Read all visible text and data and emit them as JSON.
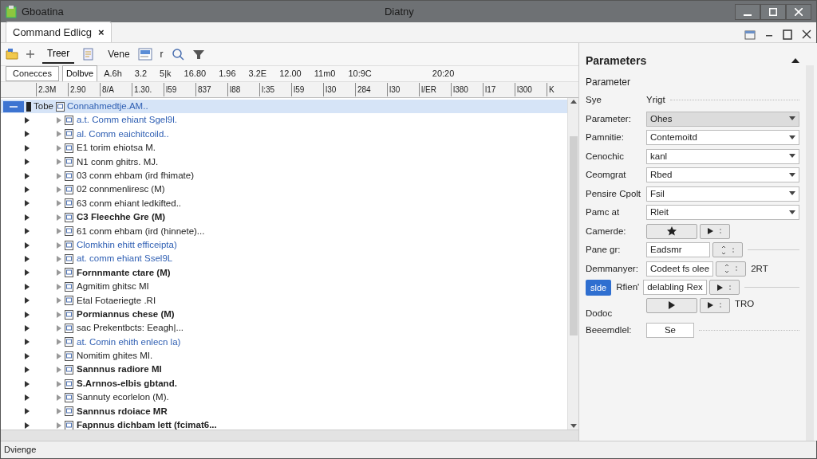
{
  "window": {
    "title": "Gboatina",
    "subtitle": "Diatny"
  },
  "tabs": [
    {
      "label": "Command Edlicg",
      "selected": true,
      "close": "×"
    }
  ],
  "toolbar": {
    "tab_label": "Treer",
    "view_label": "Vene",
    "view_suffix": "r"
  },
  "ruler": {
    "filter": "Conecces",
    "button": "Dolbve",
    "labels": [
      "A.6h",
      "3.2",
      "5|k",
      "16.80",
      "1.96",
      "3.2E",
      "12.00",
      "11m0",
      "10:9C",
      "20:20"
    ],
    "ticks": [
      "2.3M",
      "2.90",
      "8/A",
      "1.30.",
      "l59",
      "837",
      "l88",
      "l:35",
      "l59",
      "l30",
      "284",
      "l30",
      "l/ER",
      "l380",
      "l17",
      "l300",
      "K"
    ]
  },
  "tree": {
    "rows": [
      {
        "prefix": "Tobe",
        "text": "Connahmedtje.AM..",
        "color": "#2f5fb3",
        "bold": false,
        "selected": true,
        "expanded": true,
        "children": [
          {
            "text": "a.t. Comm ehiant Sgel9l.",
            "color": "#2f5fb3",
            "bold": false,
            "selected": false
          },
          {
            "text": "al. Comm eaichitcoild..",
            "color": "#2f5fb3",
            "bold": false,
            "selected": false
          },
          {
            "text": "E1 torim ehiotsa M.",
            "color": "#222222",
            "bold": false,
            "selected": false
          },
          {
            "text": "N1 conm ghitrs. MJ.",
            "color": "#222222",
            "bold": false,
            "selected": false
          },
          {
            "text": "03 conm ehbam (ird fhimate)",
            "color": "#222222",
            "bold": false,
            "selected": false
          },
          {
            "text": "02 connmenliresc (M)",
            "color": "#222222",
            "bold": false,
            "selected": false
          },
          {
            "text": "63 conm ehiant ledkifted..",
            "color": "#222222",
            "bold": false,
            "selected": false
          },
          {
            "text": "C3 Fleechhe Gre (M)",
            "color": "#222222",
            "bold": true,
            "selected": false
          },
          {
            "text": "61 conm ehbam (ird (hinnete)...",
            "color": "#222222",
            "bold": false,
            "selected": false
          },
          {
            "text": "Clomkhin ehitt efficeipta)",
            "color": "#2f5fb3",
            "bold": false,
            "selected": false
          },
          {
            "text": "at. comm ehiant Ssel9L",
            "color": "#2f5fb3",
            "bold": false,
            "selected": false
          },
          {
            "text": "Fornnmante ctare (M)",
            "color": "#222222",
            "bold": true,
            "selected": false
          },
          {
            "text": "Agmitim ghitsc MI",
            "color": "#222222",
            "bold": false,
            "selected": false
          },
          {
            "text": "Etal Fotaeriegte .RI",
            "color": "#222222",
            "bold": false,
            "selected": false
          },
          {
            "text": "Pormiannus chese (M)",
            "color": "#222222",
            "bold": true,
            "selected": false
          },
          {
            "text": "sac Prekentbcts: Eeagh|...",
            "color": "#222222",
            "bold": false,
            "selected": false
          },
          {
            "text": "at. Comin ehith enlecn la)",
            "color": "#2f5fb3",
            "bold": false,
            "selected": false
          },
          {
            "text": "Nomitim ghites MI.",
            "color": "#222222",
            "bold": false,
            "selected": false
          },
          {
            "text": "Sannnus radiore MI",
            "color": "#222222",
            "bold": true,
            "selected": false
          },
          {
            "text": "S.Arnnos-elbis gbtand.",
            "color": "#222222",
            "bold": true,
            "selected": false
          },
          {
            "text": "Sannuty ecorlelon (M).",
            "color": "#222222",
            "bold": false,
            "selected": false
          },
          {
            "text": "Sannnus rdoiace MR",
            "color": "#222222",
            "bold": true,
            "selected": false
          },
          {
            "text": "Fapnnus dichbam lett (fcimat6...",
            "color": "#222222",
            "bold": true,
            "selected": false
          }
        ]
      }
    ]
  },
  "parameters": {
    "title": "Parameters",
    "section": "Parameter",
    "rows": [
      {
        "kind": "static",
        "label": "Sye",
        "value": "Yrigt"
      },
      {
        "kind": "select",
        "label": "Parameter:",
        "value": "Ohes",
        "disabled": true
      },
      {
        "kind": "select",
        "label": "Pamnitie:",
        "value": "Contemoitd",
        "disabled": false
      },
      {
        "kind": "select",
        "label": "Cenochic",
        "value": "kanl",
        "disabled": false
      },
      {
        "kind": "select",
        "label": "Ceomgrat",
        "value": "Rbed",
        "disabled": false
      },
      {
        "kind": "select",
        "label": "Pensire Cpolt",
        "value": "Fsil",
        "disabled": false
      },
      {
        "kind": "select",
        "label": "Pamc at",
        "value": "Rleit",
        "disabled": false
      },
      {
        "kind": "buttons",
        "label": "Camerde:"
      },
      {
        "kind": "spin",
        "label": "Pane gr:",
        "value": "Eadsmr"
      },
      {
        "kind": "spin",
        "label": "Demmanyer:",
        "value": "Codeet fs olee",
        "note": "2RT"
      },
      {
        "kind": "action",
        "button": "slde",
        "label": "Rfien'",
        "value": "delabling Rex"
      },
      {
        "kind": "play",
        "label": "Dodoc",
        "note": "TRO"
      },
      {
        "kind": "input",
        "label": "Beeemdlel:",
        "value": "Se"
      }
    ]
  },
  "status_bar": "Dvienge"
}
